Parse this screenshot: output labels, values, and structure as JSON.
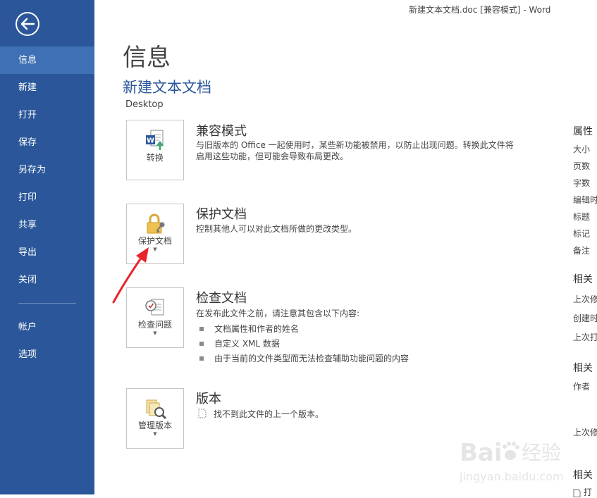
{
  "window": {
    "title": "新建文本文档.doc [兼容模式] - Word"
  },
  "sidebar": {
    "items": [
      {
        "label": "信息"
      },
      {
        "label": "新建"
      },
      {
        "label": "打开"
      },
      {
        "label": "保存"
      },
      {
        "label": "另存为"
      },
      {
        "label": "打印"
      },
      {
        "label": "共享"
      },
      {
        "label": "导出"
      },
      {
        "label": "关闭"
      }
    ],
    "bottom_items": [
      {
        "label": "帐户"
      },
      {
        "label": "选项"
      }
    ]
  },
  "main": {
    "title": "信息",
    "doc_name": "新建文本文档",
    "location": "Desktop",
    "sections": {
      "compat": {
        "button_label": "转换",
        "title": "兼容模式",
        "desc_line1": "与旧版本的 Office 一起使用时，某些新功能被禁用，以防止出现问题。转换此文件将",
        "desc_line2": "启用这些功能，但可能会导致布局更改。"
      },
      "protect": {
        "button_label": "保护文档",
        "title": "保护文档",
        "desc": "控制其他人可以对此文档所做的更改类型。"
      },
      "inspect": {
        "button_label": "检查问题",
        "title": "检查文档",
        "desc": "在发布此文件之前，请注意其包含以下内容:",
        "bullets": [
          "文档属性和作者的姓名",
          "自定义 XML 数据",
          "由于当前的文件类型而无法检查辅助功能问题的内容"
        ]
      },
      "versions": {
        "button_label": "管理版本",
        "title": "版本",
        "desc": "找不到此文件的上一个版本。"
      }
    }
  },
  "properties": {
    "header": "属性",
    "labels": [
      "大小",
      "页数",
      "字数",
      "编辑时",
      "标题",
      "标记",
      "备注"
    ],
    "related_dates_header": "相关",
    "date_labels": [
      "上次修",
      "创建时",
      "上次打"
    ],
    "related_people_header": "相关",
    "author_label": "作者",
    "last_modified_by": "上次修",
    "related_docs_header": "相关",
    "open_label": "打"
  },
  "watermark": {
    "brand": "Bai",
    "product": "经验",
    "url": "jingyan.baidu.com"
  },
  "colors": {
    "sidebar": "#2b579a",
    "sidebar_active": "#3f6fb5",
    "accent": "#2b579a",
    "arrow": "#e8252b"
  }
}
